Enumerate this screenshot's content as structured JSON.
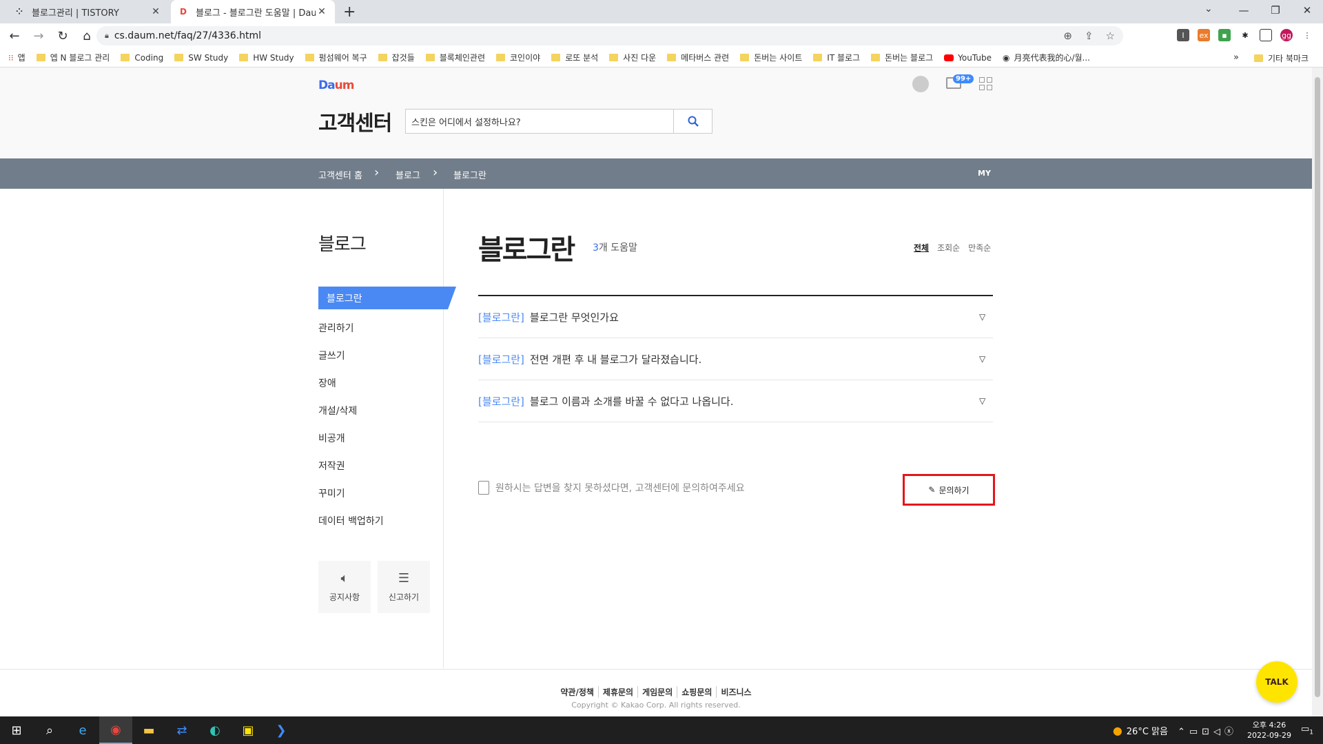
{
  "browser": {
    "tabs": [
      {
        "title": "블로그관리 | TISTORY",
        "icon": "tistory-icon"
      },
      {
        "title": "블로그 - 블로그란 도움말 | Daum",
        "icon": "daum-icon"
      }
    ],
    "url": "cs.daum.net/faq/27/4336.html",
    "bookmarks": [
      "앱",
      "엡 N 블로그 관리",
      "Coding",
      "SW Study",
      "HW Study",
      "펌섬웨어 복구",
      "잡것들",
      "블록체인관련",
      "코인이야",
      "로또 분석",
      "사진 다운",
      "메타버스 관련",
      "돈버는 사이트",
      "IT 블로그",
      "돈버는 블로그",
      "YouTube",
      "月亮代表我的心/월..."
    ],
    "bookmarks_more": "»",
    "other_bookmarks": "기타 북마크",
    "profile": "gg"
  },
  "header": {
    "logo_da": "Da",
    "logo_um": "um",
    "title": "고객센터",
    "search_value": "스킨은 어디에서 설정하나요?",
    "mail_badge": "99+"
  },
  "breadcrumb": {
    "items": [
      "고객센터 홈",
      "블로그",
      "블로그란"
    ],
    "my": "MY"
  },
  "sidebar": {
    "title": "블로그",
    "items": [
      "블로그란",
      "관리하기",
      "글쓰기",
      "장애",
      "개설/삭제",
      "비공개",
      "저작권",
      "꾸미기",
      "데이터 백업하기"
    ],
    "boxes": [
      {
        "label": "공지사항",
        "icon": "speaker-icon"
      },
      {
        "label": "신고하기",
        "icon": "document-icon"
      }
    ]
  },
  "main": {
    "title": "블로그란",
    "count_num": "3",
    "count_label": "개 도움말",
    "sorts": [
      "전체",
      "조회순",
      "만족순"
    ],
    "questions": [
      {
        "tag": "[블로그란]",
        "text": "블로그란 무엇인가요"
      },
      {
        "tag": "[블로그란]",
        "text": "전면 개편 후 내 블로그가 달라졌습니다."
      },
      {
        "tag": "[블로그란]",
        "text": "블로그 이름과 소개를 바꿀 수 없다고 나옵니다."
      }
    ],
    "inquiry_text": "원하시는 답변을 찾지 못하셨다면, 고객센터에 문의하여주세요",
    "inquiry_button": "문의하기"
  },
  "footer": {
    "links": [
      "약관/정책",
      "제휴문의",
      "게임문의",
      "쇼핑문의",
      "비즈니스"
    ],
    "copyright": "Copyright © Kakao Corp. All rights reserved.",
    "talk": "TALK"
  },
  "taskbar": {
    "weather": "26°C 맑음",
    "time": "오후 4:26",
    "date": "2022-09-29",
    "notifications": "1"
  }
}
